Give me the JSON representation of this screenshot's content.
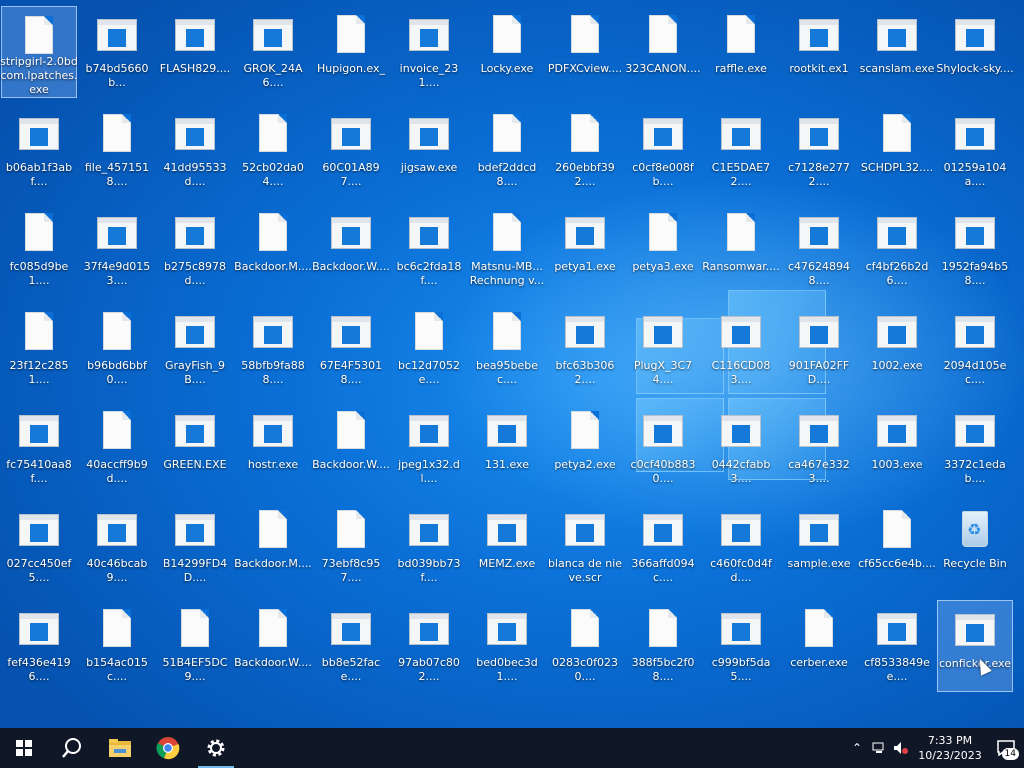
{
  "desktop": {
    "icons": [
      {
        "label": "stripgirl-2.0bdcom.lpatches.exe",
        "type": "doc",
        "selected": true
      },
      {
        "label": "b74bd5660b...",
        "type": "app"
      },
      {
        "label": "FLASH829....",
        "type": "app"
      },
      {
        "label": "GROK_24A6....",
        "type": "app"
      },
      {
        "label": "Hupigon.ex_",
        "type": "doc"
      },
      {
        "label": "invoice_231....",
        "type": "app"
      },
      {
        "label": "Locky.exe",
        "type": "doc"
      },
      {
        "label": "PDFXCview....",
        "type": "doc"
      },
      {
        "label": "323CANON....",
        "type": "doc"
      },
      {
        "label": "raffle.exe",
        "type": "doc"
      },
      {
        "label": "rootkit.ex1",
        "type": "app"
      },
      {
        "label": "scanslam.exe",
        "type": "app"
      },
      {
        "label": "Shylock-sky....",
        "type": "app"
      },
      {
        "label": "b06ab1f3abf....",
        "type": "app"
      },
      {
        "label": "file_4571518....",
        "type": "doc"
      },
      {
        "label": "41dd95533d....",
        "type": "app"
      },
      {
        "label": "52cb02da04....",
        "type": "doc"
      },
      {
        "label": "60C01A897....",
        "type": "app"
      },
      {
        "label": "jigsaw.exe",
        "type": "app"
      },
      {
        "label": "bdef2ddcd8....",
        "type": "doc"
      },
      {
        "label": "260ebbf392....",
        "type": "doc"
      },
      {
        "label": "c0cf8e008fb....",
        "type": "app"
      },
      {
        "label": "C1E5DAE72....",
        "type": "app"
      },
      {
        "label": "c7128e2772....",
        "type": "app"
      },
      {
        "label": "SCHDPL32....",
        "type": "doc"
      },
      {
        "label": "01259a104a....",
        "type": "app"
      },
      {
        "label": "fc085d9be1....",
        "type": "doc"
      },
      {
        "label": "37f4e9d0153....",
        "type": "app"
      },
      {
        "label": "b275c8978d....",
        "type": "app"
      },
      {
        "label": "Backdoor.M....",
        "type": "doc"
      },
      {
        "label": "Backdoor.W....",
        "type": "app"
      },
      {
        "label": "bc6c2fda18f....",
        "type": "app"
      },
      {
        "label": "Matsnu-MB...Rechnung v...",
        "type": "doc"
      },
      {
        "label": "petya1.exe",
        "type": "app"
      },
      {
        "label": "petya3.exe",
        "type": "doc"
      },
      {
        "label": "Ransomwar....",
        "type": "doc"
      },
      {
        "label": "c476248948....",
        "type": "app"
      },
      {
        "label": "cf4bf26b2d6....",
        "type": "app"
      },
      {
        "label": "1952fa94b58....",
        "type": "app"
      },
      {
        "label": "23f12c2851....",
        "type": "doc"
      },
      {
        "label": "b96bd6bbf0....",
        "type": "doc"
      },
      {
        "label": "GrayFish_9B....",
        "type": "app"
      },
      {
        "label": "58bfb9fa888....",
        "type": "app"
      },
      {
        "label": "67E4F53018....",
        "type": "app"
      },
      {
        "label": "bc12d7052e....",
        "type": "doc"
      },
      {
        "label": "bea95bebec....",
        "type": "doc"
      },
      {
        "label": "bfc63b3062....",
        "type": "app"
      },
      {
        "label": "PlugX_3C74....",
        "type": "app"
      },
      {
        "label": "C116CD083....",
        "type": "app"
      },
      {
        "label": "901FA02FFD....",
        "type": "app"
      },
      {
        "label": "1002.exe",
        "type": "app"
      },
      {
        "label": "2094d105ec....",
        "type": "app"
      },
      {
        "label": "fc75410aa8f....",
        "type": "app"
      },
      {
        "label": "40accff9b9d....",
        "type": "doc"
      },
      {
        "label": "GREEN.EXE",
        "type": "app"
      },
      {
        "label": "hostr.exe",
        "type": "app"
      },
      {
        "label": "Backdoor.W....",
        "type": "doc"
      },
      {
        "label": "jpeg1x32.dl....",
        "type": "app"
      },
      {
        "label": "131.exe",
        "type": "app"
      },
      {
        "label": "petya2.exe",
        "type": "doc"
      },
      {
        "label": "c0cf40b8830....",
        "type": "app"
      },
      {
        "label": "0442cfabb3....",
        "type": "app"
      },
      {
        "label": "ca467e3323....",
        "type": "app"
      },
      {
        "label": "1003.exe",
        "type": "app"
      },
      {
        "label": "3372c1edab....",
        "type": "app"
      },
      {
        "label": "027cc450ef5....",
        "type": "app"
      },
      {
        "label": "40c46bcab9....",
        "type": "app"
      },
      {
        "label": "B14299FD4D....",
        "type": "app"
      },
      {
        "label": "Backdoor.M....",
        "type": "doc"
      },
      {
        "label": "73ebf8c957....",
        "type": "doc"
      },
      {
        "label": "bd039bb73f....",
        "type": "app"
      },
      {
        "label": "MEMZ.exe",
        "type": "app"
      },
      {
        "label": "blanca de nieve.scr",
        "type": "app"
      },
      {
        "label": "366affd094c....",
        "type": "app"
      },
      {
        "label": "c460fc0d4fd....",
        "type": "app"
      },
      {
        "label": "sample.exe",
        "type": "app"
      },
      {
        "label": "cf65cc6e4b....",
        "type": "doc"
      },
      {
        "label": "Recycle Bin",
        "type": "bin"
      },
      {
        "label": "fef436e4196....",
        "type": "app"
      },
      {
        "label": "b154ac015c....",
        "type": "doc"
      },
      {
        "label": "51B4EF5DC9....",
        "type": "doc"
      },
      {
        "label": "Backdoor.W....",
        "type": "doc"
      },
      {
        "label": "bb8e52face....",
        "type": "app"
      },
      {
        "label": "97ab07c802....",
        "type": "app"
      },
      {
        "label": "bed0bec3d1....",
        "type": "app"
      },
      {
        "label": "0283c0f0230....",
        "type": "doc"
      },
      {
        "label": "388f5bc2f08....",
        "type": "doc"
      },
      {
        "label": "c999bf5da5....",
        "type": "app"
      },
      {
        "label": "cerber.exe",
        "type": "doc"
      },
      {
        "label": "cf8533849ee....",
        "type": "app"
      },
      {
        "label": "conficker.exe",
        "type": "app",
        "selected": true
      }
    ]
  },
  "taskbar": {
    "start_icon": "windows-start-icon",
    "search_icon": "search-icon",
    "file_explorer_icon": "folder-icon",
    "chrome_icon": "chrome-icon",
    "settings_icon": "gear-icon",
    "tray": {
      "time": "7:33 PM",
      "date": "10/23/2023",
      "notifications": "14"
    }
  }
}
